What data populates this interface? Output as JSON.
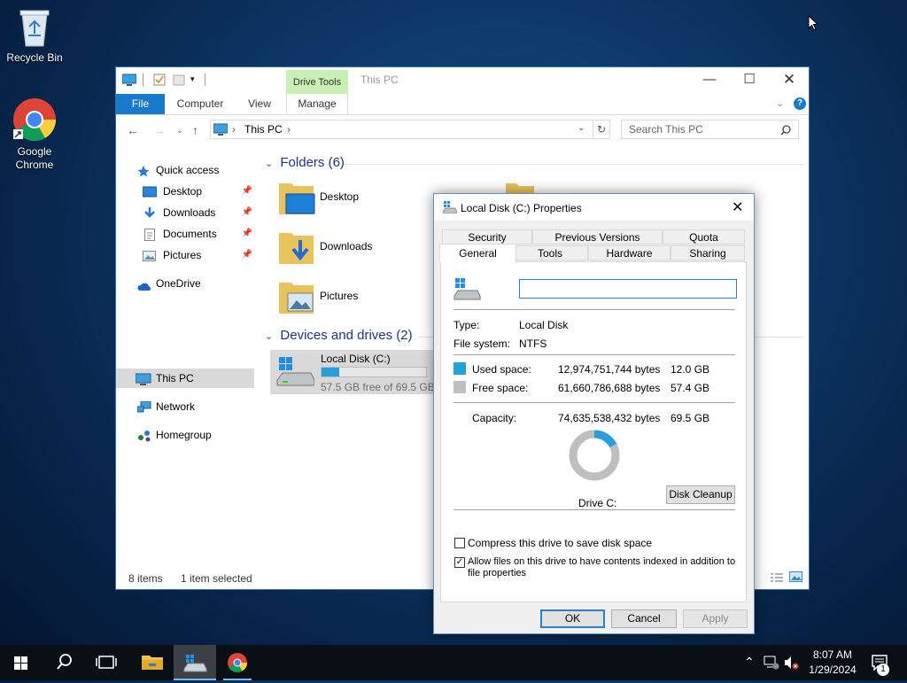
{
  "desktop": {
    "icons": [
      {
        "label": "Recycle Bin"
      },
      {
        "label": "Google Chrome"
      }
    ]
  },
  "explorer": {
    "context_tab": "Drive Tools",
    "title": "This PC",
    "ribbon_tabs": [
      "File",
      "Computer",
      "View",
      "Manage"
    ],
    "breadcrumb": "This PC",
    "search_placeholder": "Search This PC",
    "nav": {
      "quick_access": "Quick access",
      "pinned": [
        "Desktop",
        "Downloads",
        "Documents",
        "Pictures"
      ],
      "onedrive": "OneDrive",
      "this_pc": "This PC",
      "network": "Network",
      "homegroup": "Homegroup"
    },
    "folders_header": "Folders (6)",
    "folders": [
      "Desktop",
      "Downloads",
      "Pictures"
    ],
    "devices_header": "Devices and drives (2)",
    "drive": {
      "name": "Local Disk (C:)",
      "free_text": "57.5 GB free of 69.5 GB",
      "used_fraction": 0.173
    },
    "status": {
      "items": "8 items",
      "selected": "1 item selected"
    },
    "accent": "#1979ca"
  },
  "dialog": {
    "title": "Local Disk (C:) Properties",
    "tabs_row1": [
      "Security",
      "Previous Versions",
      "Quota"
    ],
    "tabs_row2": [
      "General",
      "Tools",
      "Hardware",
      "Sharing"
    ],
    "name_value": "",
    "type_label": "Type:",
    "type_value": "Local Disk",
    "fs_label": "File system:",
    "fs_value": "NTFS",
    "used_label": "Used space:",
    "used_bytes": "12,974,751,744 bytes",
    "used_gb": "12.0 GB",
    "free_label": "Free space:",
    "free_bytes": "61,660,786,688 bytes",
    "free_gb": "57.4 GB",
    "capacity_label": "Capacity:",
    "capacity_bytes": "74,635,538,432 bytes",
    "capacity_gb": "69.5 GB",
    "drive_label": "Drive C:",
    "cleanup_label": "Disk Cleanup",
    "compress_label": "Compress this drive to save disk space",
    "compress_checked": false,
    "index_label_1": "Allow files on this drive to have contents indexed in addition to",
    "index_label_2": "file properties",
    "index_checked": true,
    "ok_label": "OK",
    "cancel_label": "Cancel",
    "apply_label": "Apply",
    "used_color": "#26a0da",
    "free_color": "#bfbfbf",
    "used_fraction": 0.174
  },
  "taskbar": {
    "time": "8:07 AM",
    "date": "1/29/2024",
    "notification_count": "1"
  }
}
